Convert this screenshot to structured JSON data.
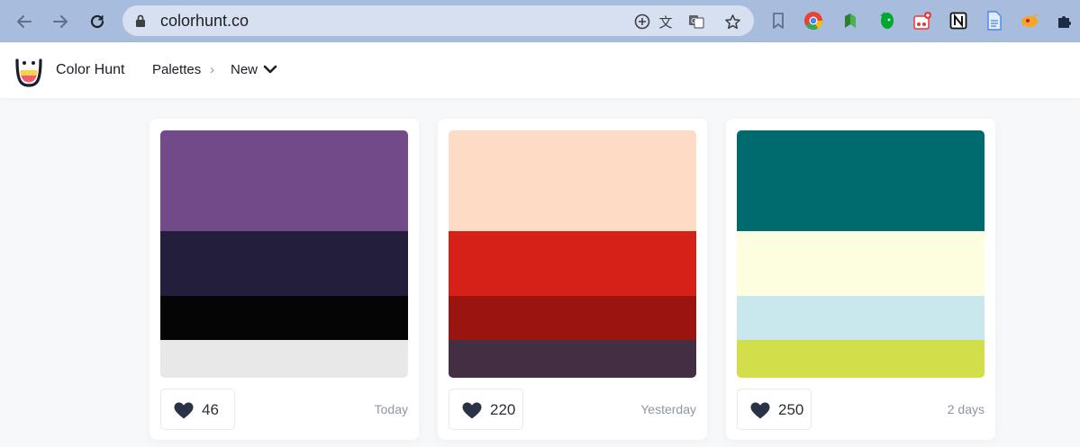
{
  "browser": {
    "url": "colorhunt.co",
    "icons": [
      "back-arrow-icon",
      "forward-arrow-icon",
      "reload-icon",
      "lock-icon",
      "add-icon",
      "translate-icon",
      "google-translate-icon",
      "star-icon",
      "bookmark-icon",
      "chrome-icon",
      "extension-icon",
      "evernote-icon",
      "extension-icon",
      "notion-icon",
      "document-icon",
      "extension-icon",
      "puzzle-icon"
    ]
  },
  "header": {
    "brand": "Color Hunt",
    "crumb_palettes": "Palettes",
    "crumb_sep": "›",
    "crumb_new": "New"
  },
  "palettes": [
    {
      "colors": [
        "#734a89",
        "#221e3b",
        "#050505",
        "#e8e8e8"
      ],
      "likes": "46",
      "date": "Today"
    },
    {
      "colors": [
        "#fedbc4",
        "#d62118",
        "#9a1410",
        "#442e43"
      ],
      "likes": "220",
      "date": "Yesterday"
    },
    {
      "colors": [
        "#006b6e",
        "#fdfddf",
        "#c8e8ed",
        "#d2df4a"
      ],
      "likes": "250",
      "date": "2 days"
    }
  ]
}
